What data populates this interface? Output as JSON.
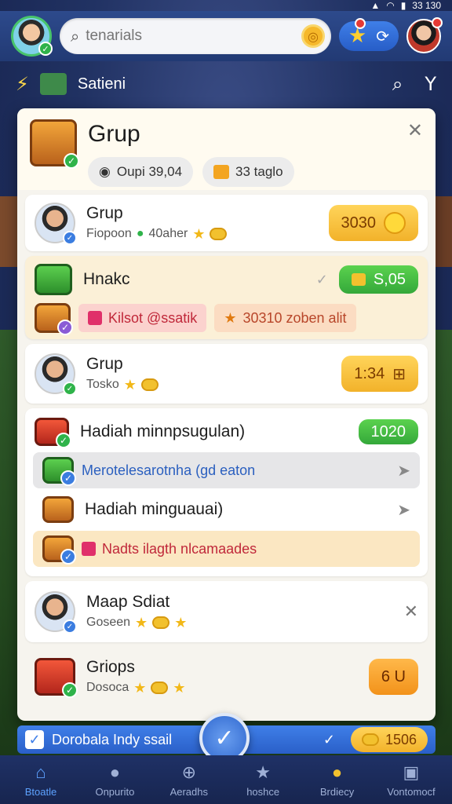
{
  "status_bar": {
    "text": "33 130"
  },
  "search": {
    "placeholder": "tenarials"
  },
  "subbar": {
    "title": "Satieni"
  },
  "panel": {
    "title": "Grup",
    "chip1": "Oupi 39,04",
    "chip2": "33 taglo"
  },
  "rows": [
    {
      "title": "Grup",
      "sub": "Fiopoon",
      "sub2": "40aher",
      "badge": "3030"
    },
    {
      "title": "Hnakc",
      "badge": "S,05"
    }
  ],
  "tags": {
    "t1": "Kilsot @ssatik",
    "t2": "30310 zoben alit"
  },
  "row3": {
    "title": "Grup",
    "sub": "Tosko",
    "badge": "1:34"
  },
  "reward": {
    "title": "Hadiah minnpsugulan)",
    "badge": "1020",
    "line1": "Merotelesarotnha (gd eaton",
    "title2": "Hadiah minguauai)",
    "line2": "Nadts ilagth nlcamaades"
  },
  "row4": {
    "title": "Maap Sdiat",
    "sub": "Goseen"
  },
  "row5": {
    "title": "Griops",
    "sub": "Dosoca",
    "badge": "6 U"
  },
  "strip": {
    "label": "Dorobala Indy ssail",
    "gold": "1506"
  },
  "nav": [
    "Btoatle",
    "Onpurito",
    "Aeradhs",
    "hoshce",
    "Brdiecy",
    "Vontomocf"
  ]
}
